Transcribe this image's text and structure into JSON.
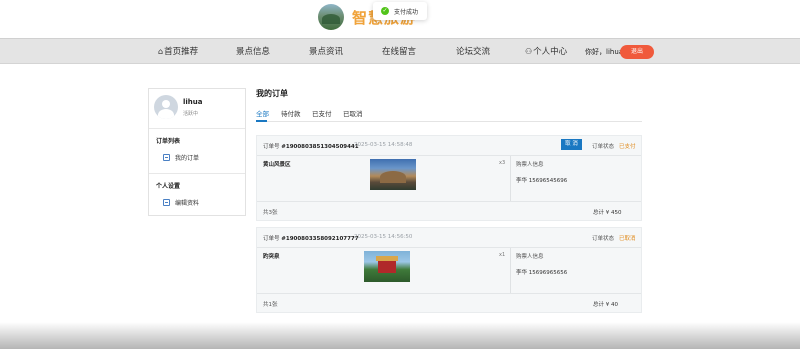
{
  "brand": {
    "title": "智慧旅游"
  },
  "toast": {
    "icon": "check-circle-icon",
    "message": "支付成功"
  },
  "nav": {
    "items": [
      {
        "icon": "home-icon",
        "label": "首页推荐"
      },
      {
        "label": "景点信息"
      },
      {
        "label": "景点资讯"
      },
      {
        "label": "在线留言"
      },
      {
        "label": "论坛交流"
      },
      {
        "icon": "user-icon",
        "label": "个人中心"
      }
    ],
    "greeting": "你好，lihua",
    "logout_label": "退出"
  },
  "sidebar": {
    "username": "lihua",
    "status": "活跃中",
    "sections": [
      {
        "heading": "订单列表",
        "link": "我的订单",
        "icon": "order-icon"
      },
      {
        "heading": "个人设置",
        "link": "编辑资料",
        "icon": "edit-icon"
      }
    ]
  },
  "main": {
    "title": "我的订单",
    "tabs": [
      "全部",
      "待付款",
      "已支付",
      "已取消"
    ],
    "active_tab": "全部"
  },
  "orders": [
    {
      "number_label": "订单号",
      "number": "#1900803851304509441",
      "time": "2025-03-15 14:58:48",
      "cancel_label": "取 消",
      "status_label": "订单状态",
      "status": "已支付",
      "item_name": "黄山风景区",
      "qty": "x3",
      "buyer_label": "购票人信息",
      "buyer": "李华 15696545696",
      "count": "共3张",
      "total": "总计 ¥ 450"
    },
    {
      "number_label": "订单号",
      "number": "#1900803358092107777",
      "time": "2025-03-15 14:56:50",
      "status_label": "订单状态",
      "status": "已取消",
      "item_name": "趵突泉",
      "qty": "x1",
      "buyer_label": "购票人信息",
      "buyer": "李华 15696965656",
      "count": "共1张",
      "total": "总计 ¥ 40"
    }
  ],
  "colors": {
    "accent": "#1a78c2",
    "brand": "#f0a33a",
    "logout": "#f05a3c",
    "status": "#e08a1a"
  }
}
